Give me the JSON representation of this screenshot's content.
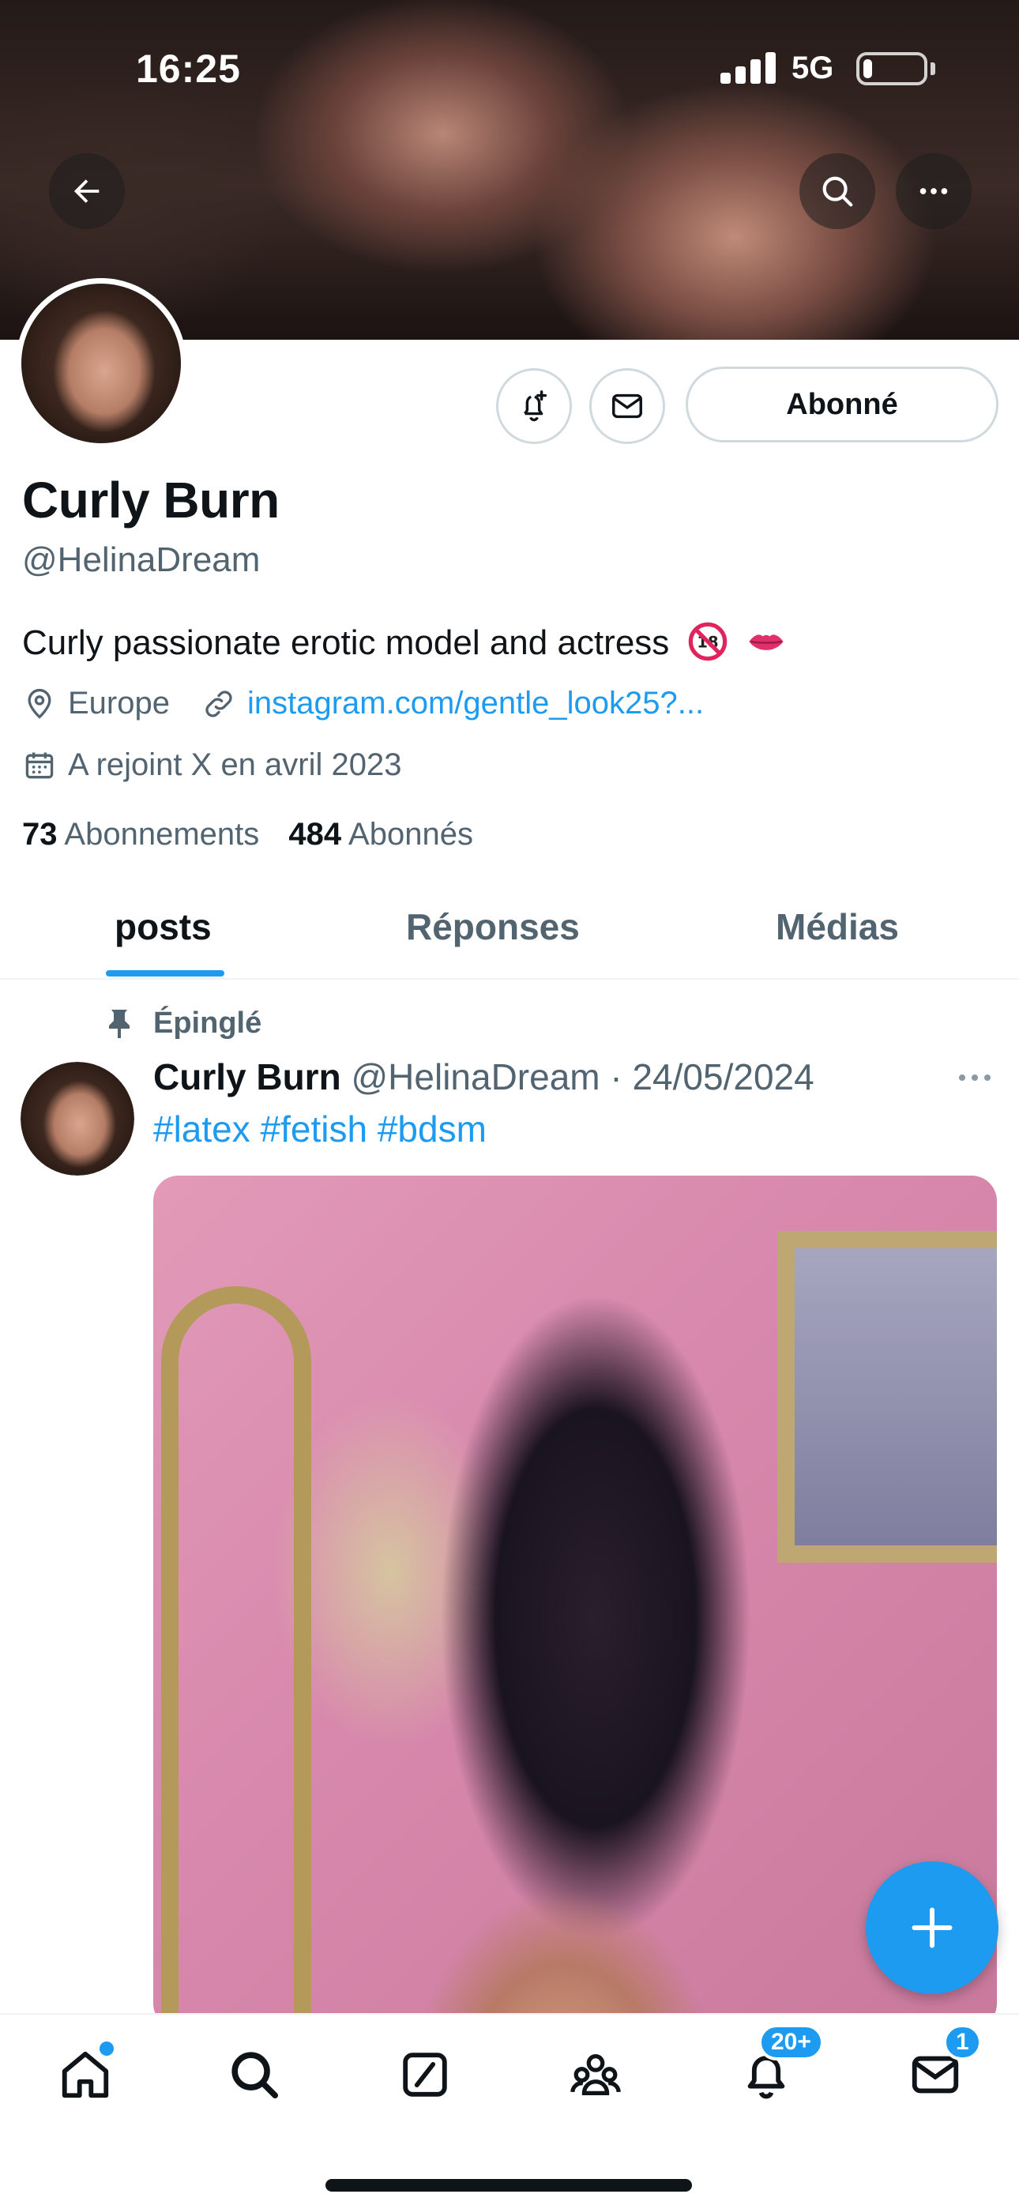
{
  "status_bar": {
    "time": "16:25",
    "network": "5G",
    "battery_level": 0.15
  },
  "profile": {
    "display_name": "Curly Burn",
    "handle": "@HelinaDream",
    "bio": "Curly passionate erotic model and actress",
    "bio_emojis": [
      "no-under-18-emoji",
      "lips-emoji"
    ],
    "location": "Europe",
    "link": "instagram.com/gentle_look25?...",
    "joined": "A rejoint X en avril 2023",
    "following_count": "73",
    "following_label": "Abonnements",
    "followers_count": "484",
    "followers_label": "Abonnés",
    "follow_button_label": "Abonné"
  },
  "tabs": [
    {
      "label": "posts",
      "active": true
    },
    {
      "label": "Réponses",
      "active": false
    },
    {
      "label": "Médias",
      "active": false
    }
  ],
  "pinned_post": {
    "pinned_label": "Épinglé",
    "author": "Curly Burn",
    "meta": "@HelinaDream · 24/05/2024",
    "text": "#latex #fetish #bdsm"
  },
  "bottom_nav": {
    "items": [
      "home-icon",
      "search-icon",
      "compose-icon",
      "communities-icon",
      "notifications-icon",
      "messages-icon"
    ],
    "notifications_badge": "20+",
    "messages_badge": "1"
  },
  "colors": {
    "accent": "#1d9bf0",
    "text": "#0f1419",
    "muted": "#536471",
    "border": "#cfd9de"
  }
}
